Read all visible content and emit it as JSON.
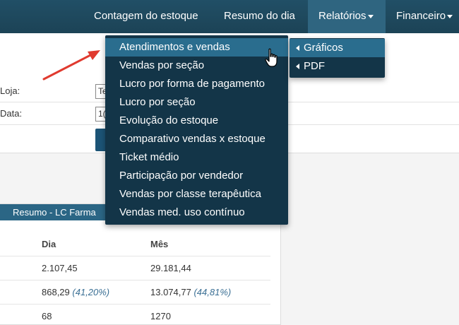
{
  "navbar": {
    "items": [
      {
        "label": "Contagem do estoque"
      },
      {
        "label": "Resumo do dia"
      },
      {
        "label": "Relatórios"
      },
      {
        "label": "Financeiro"
      }
    ]
  },
  "form": {
    "loja_label": "Loja:",
    "loja_value": "Te",
    "data_label": "Data:",
    "data_value": "1("
  },
  "dropdown": {
    "items": [
      {
        "label": "Atendimentos e vendas"
      },
      {
        "label": "Vendas por seção"
      },
      {
        "label": "Lucro por forma de pagamento"
      },
      {
        "label": "Lucro por seção"
      },
      {
        "label": "Evolução do estoque"
      },
      {
        "label": "Comparativo vendas x estoque"
      },
      {
        "label": "Ticket médio"
      },
      {
        "label": "Participação por vendedor"
      },
      {
        "label": "Vendas por classe terapêutica"
      },
      {
        "label": "Vendas med. uso contínuo"
      }
    ],
    "submenu": [
      {
        "label": "Gráficos"
      },
      {
        "label": "PDF"
      }
    ]
  },
  "summary": {
    "header": "Resumo - LC Farma",
    "columns": [
      "Dia",
      "Mês"
    ],
    "rows": [
      {
        "dia": "2.107,45",
        "dia_pct": "",
        "mes": "29.181,44",
        "mes_pct": ""
      },
      {
        "dia": "868,29",
        "dia_pct": "(41,20%)",
        "mes": "13.074,77",
        "mes_pct": "(44,81%)"
      },
      {
        "dia": "68",
        "dia_pct": "",
        "mes": "1270",
        "mes_pct": ""
      }
    ]
  },
  "colors": {
    "navbar": "#1c4356",
    "dropdown": "#133548",
    "hover": "#2a6d8e",
    "annotation_arrow": "#e03a2f"
  }
}
